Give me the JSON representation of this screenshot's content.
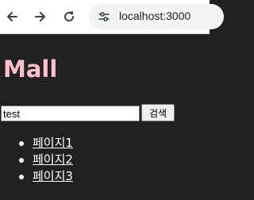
{
  "browser": {
    "url": "localhost:3000",
    "icons": {
      "back": "arrow-left",
      "forward": "arrow-right",
      "reload": "reload",
      "site_info": "site-info-tune"
    }
  },
  "page": {
    "title": "Mall",
    "search": {
      "value": "test",
      "button_label": "검색"
    },
    "nav_links": [
      {
        "label": "페이지1"
      },
      {
        "label": "페이지2"
      },
      {
        "label": "페이지3"
      }
    ],
    "colors": {
      "background": "#212121",
      "title": "#ffc0cb",
      "link": "#ffffff"
    }
  }
}
